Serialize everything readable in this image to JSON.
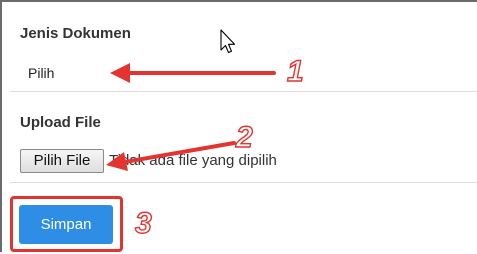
{
  "form": {
    "document_type": {
      "label": "Jenis Dokumen",
      "selected_value": "Pilih"
    },
    "upload": {
      "label": "Upload File",
      "choose_button_label": "Pilih File",
      "status_text": "Tidak ada file yang dipilih"
    },
    "save_button_label": "Simpan"
  },
  "annotations": {
    "step_1": "1",
    "step_2": "2",
    "step_3": "3",
    "color": "#e3342f"
  },
  "icons": {
    "cursor": "mouse-pointer-icon"
  },
  "colors": {
    "primary_button": "#2e8ee6",
    "highlight": "#e3342f"
  }
}
